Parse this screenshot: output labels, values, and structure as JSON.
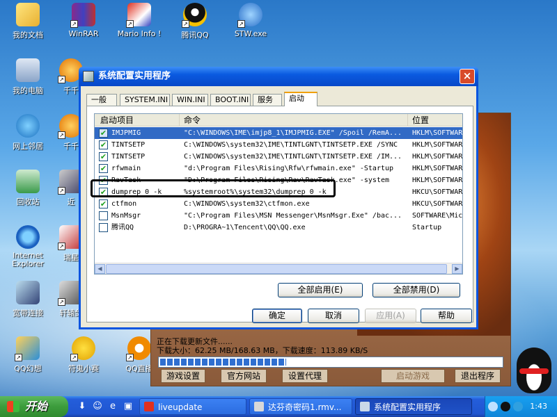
{
  "desktop": {
    "icons": [
      {
        "label": "我的文档"
      },
      {
        "label": "WinRAR"
      },
      {
        "label": "Mario Info !"
      },
      {
        "label": "腾讯QQ"
      },
      {
        "label": "STW.exe"
      },
      {
        "label": "我的电脑"
      },
      {
        "label": "千千"
      },
      {
        "label": "网上邻居"
      },
      {
        "label": "千千"
      },
      {
        "label": "回收站"
      },
      {
        "label": "近"
      },
      {
        "label": "Internet Explorer"
      },
      {
        "label": "瑞星"
      },
      {
        "label": "宽带连接"
      },
      {
        "label": "轩辕剑"
      },
      {
        "label": "QQ幻想"
      },
      {
        "label": "符鬼小赛"
      },
      {
        "label": "QQ直播"
      }
    ]
  },
  "launcher": {
    "status_line": "正在下载更新文件......",
    "progress_line": "下载大小：62.25 MB/168.63 MB，下载速度：113.89 KB/S",
    "progress_fraction": 0.37,
    "buttons": {
      "settings": "游戏设置",
      "website": "官方网站",
      "proxy": "设置代理",
      "start": "启动游戏",
      "exit": "退出程序"
    }
  },
  "dialog": {
    "title": "系统配置实用程序",
    "close_glyph": "×",
    "tabs": [
      "一般",
      "SYSTEM.INI",
      "WIN.INI",
      "BOOT.INI",
      "服务",
      "启动"
    ],
    "columns": {
      "item": "启动项目",
      "command": "命令",
      "location": "位置"
    },
    "rows": [
      {
        "item": "IMJPMIG",
        "command": "\"C:\\WINDOWS\\IME\\imjp8_1\\IMJPMIG.EXE\" /Spoil /RemA...",
        "location": "HKLM\\SOFTWARE",
        "checked": "✔"
      },
      {
        "item": "TINTSETP",
        "command": "C:\\WINDOWS\\system32\\IME\\TINTLGNT\\TINTSETP.EXE /SYNC",
        "location": "HKLM\\SOFTWARE",
        "checked": "✔"
      },
      {
        "item": "TINTSETP",
        "command": "C:\\WINDOWS\\system32\\IME\\TINTLGNT\\TINTSETP.EXE /IM...",
        "location": "HKLM\\SOFTWARE",
        "checked": "✔"
      },
      {
        "item": "rfwmain",
        "command": "\"d:\\Program Files\\Rising\\Rfw\\rfwmain.exe\" -Startup",
        "location": "HKLM\\SOFTWARE",
        "checked": "✔"
      },
      {
        "item": "RavTask",
        "command": "\"D:\\Program Files\\Rising\\Rav\\RavTask.exe\" -system",
        "location": "HKLM\\SOFTWARE",
        "checked": "✔"
      },
      {
        "item": "dumprep 0 -k",
        "command": "%systemroot%\\system32\\dumprep 0 -k",
        "location": "HKCU\\SOFTWARE",
        "checked": "✔"
      },
      {
        "item": "ctfmon",
        "command": "C:\\WINDOWS\\system32\\ctfmon.exe",
        "location": "HKCU\\SOFTWARE",
        "checked": "✔"
      },
      {
        "item": "MsnMsgr",
        "command": "\"C:\\Program Files\\MSN Messenger\\MsnMsgr.Exe\" /bac...",
        "location": "SOFTWARE\\Mic",
        "checked": ""
      },
      {
        "item": "腾讯QQ",
        "command": "D:\\PROGRA~1\\Tencent\\QQ\\QQ.exe",
        "location": "Startup",
        "checked": ""
      }
    ],
    "enable_all": "全部启用(E)",
    "disable_all": "全部禁用(D)",
    "ok": "确定",
    "cancel": "取消",
    "apply": "应用(A)",
    "help": "帮助"
  },
  "taskbar": {
    "start": "开始",
    "buttons": [
      "liveupdate",
      "达芬奇密码1.rmv...",
      "系统配置实用程序"
    ],
    "clock": "1:43"
  }
}
